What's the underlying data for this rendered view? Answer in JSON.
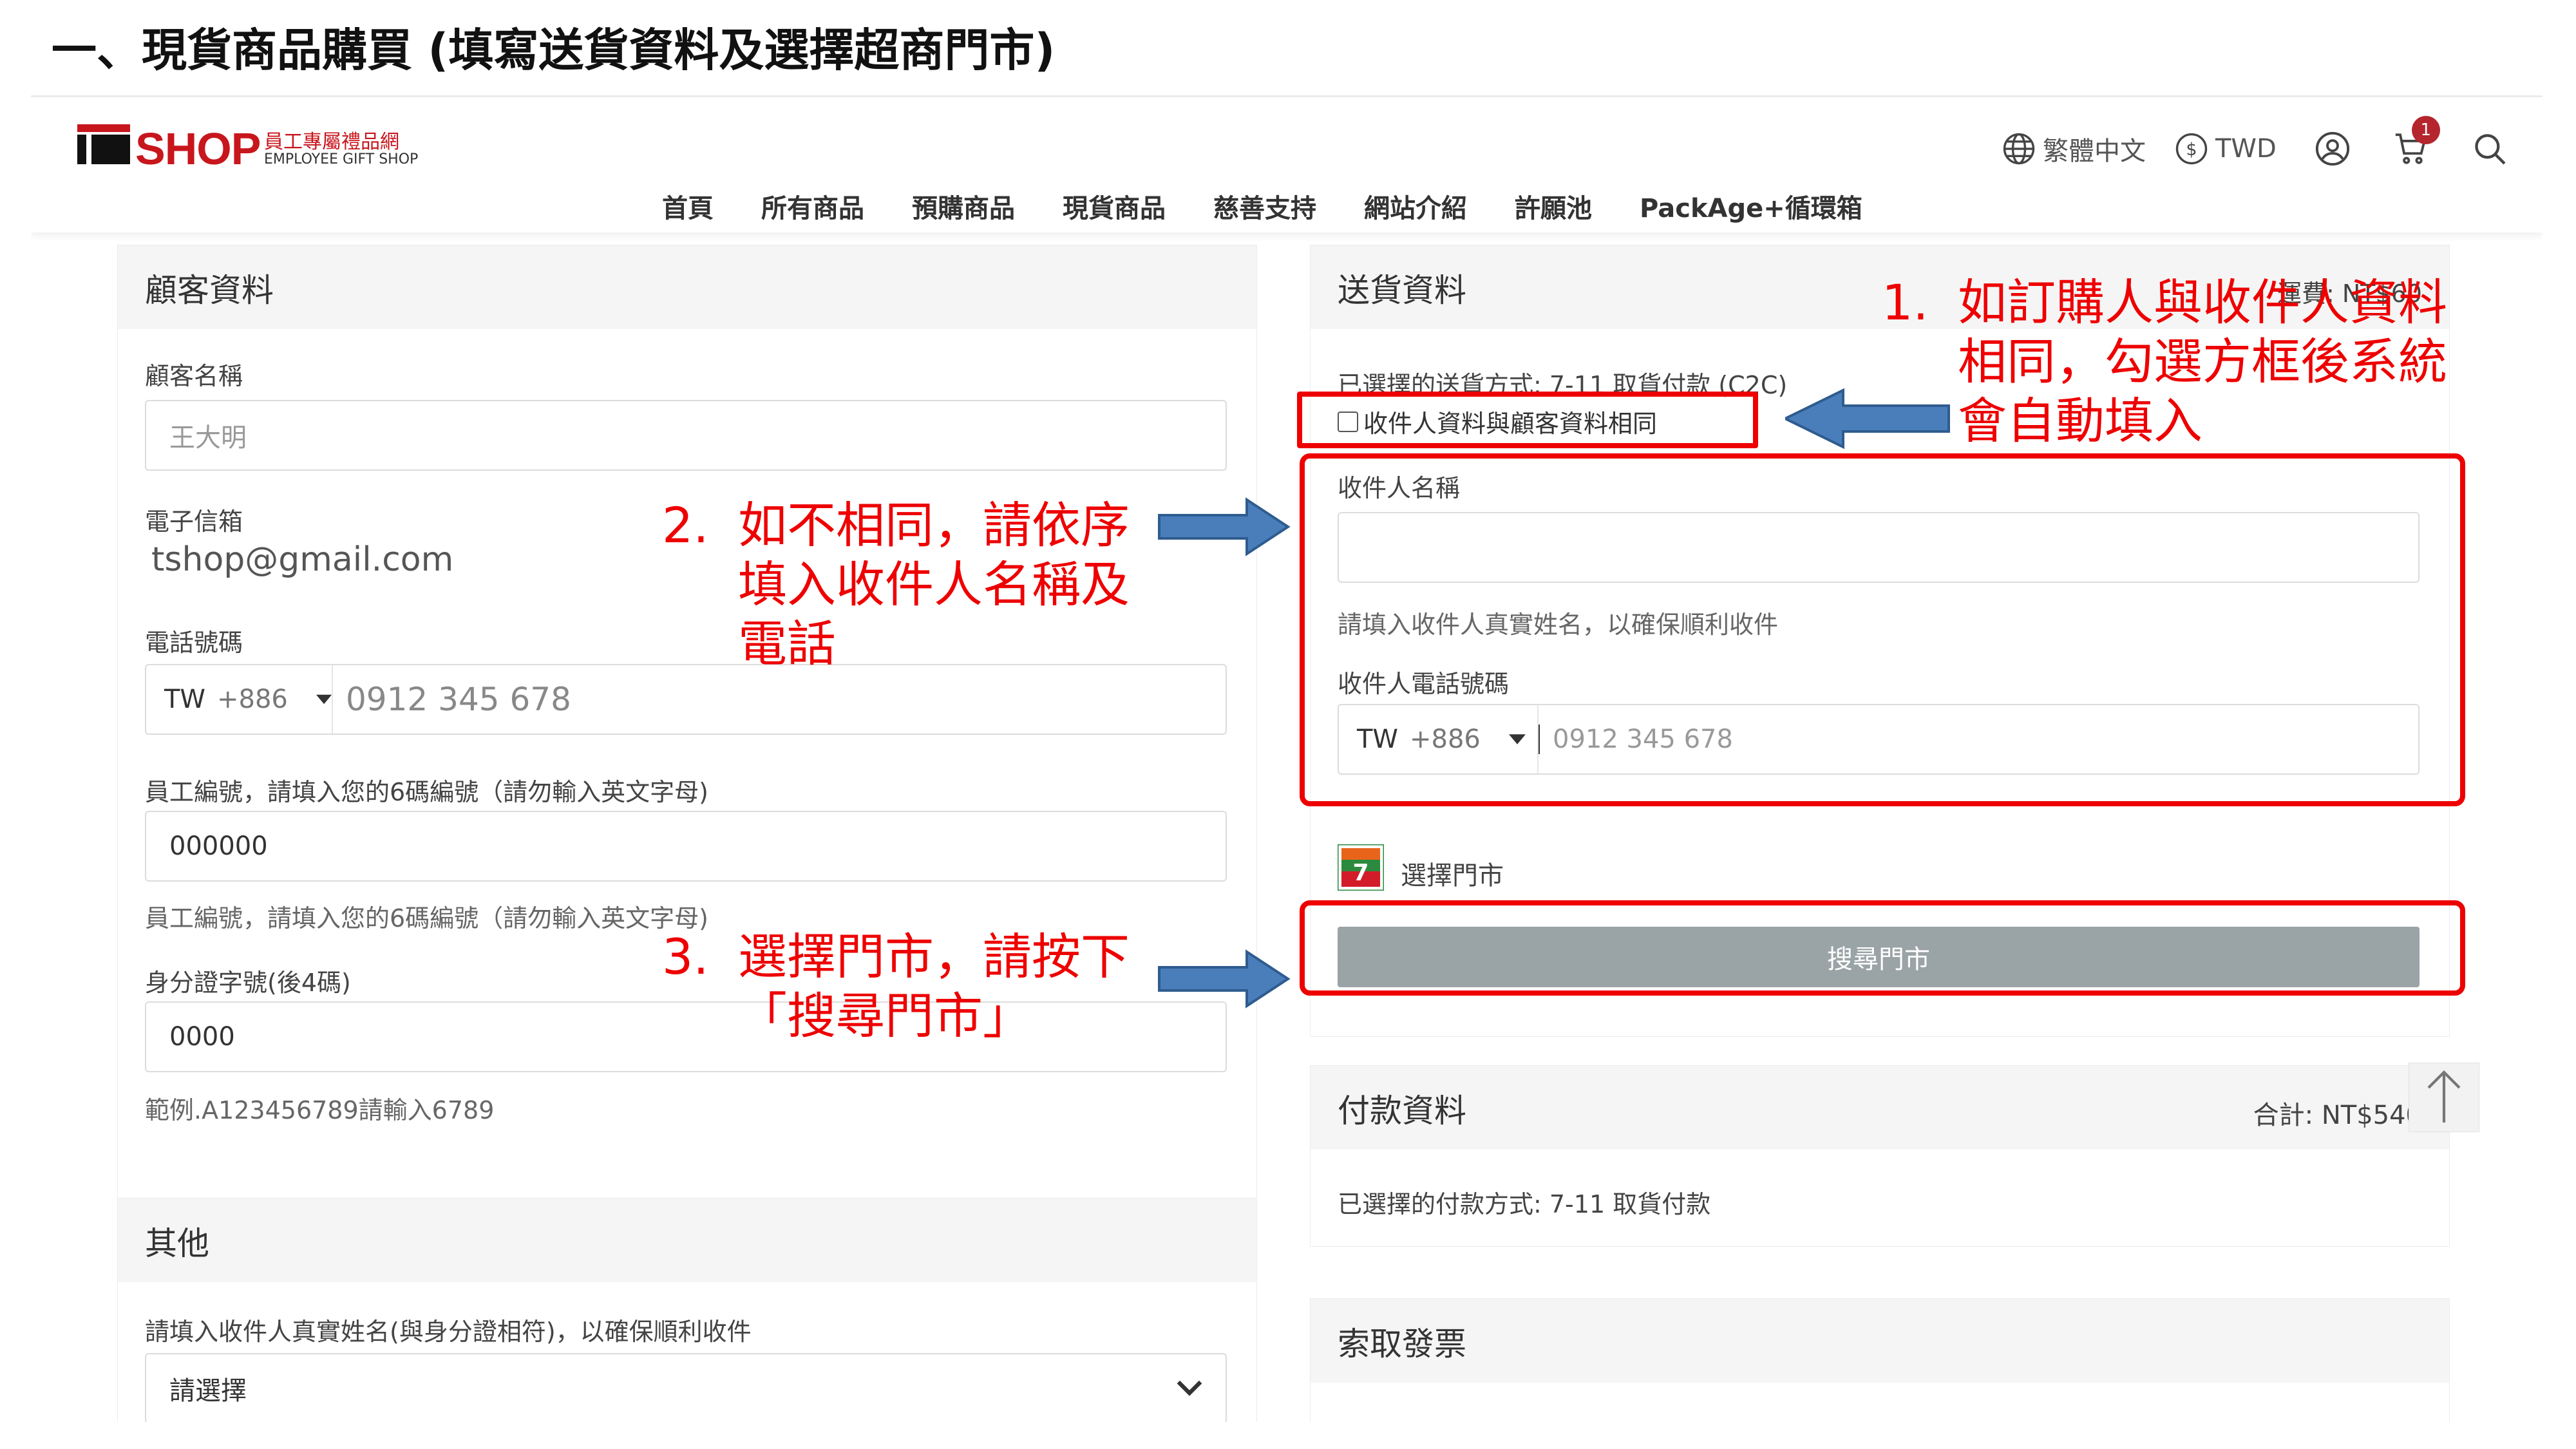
{
  "slide_title": "一、現貨商品購買 (填寫送貨資料及選擇超商門市)",
  "header": {
    "logo_text": "SHOP",
    "logo_sub_zh": "員工專屬禮品網",
    "logo_sub_en": "EMPLOYEE GIFT SHOP",
    "language": "繁體中文",
    "currency": "TWD",
    "cart_count": "1",
    "nav": [
      "首頁",
      "所有商品",
      "預購商品",
      "現貨商品",
      "慈善支持",
      "網站介紹",
      "許願池",
      "PackAge+循環箱"
    ]
  },
  "customer": {
    "title": "顧客資料",
    "name_label": "顧客名稱",
    "name_value": "王大明",
    "email_label": "電子信箱",
    "email_value": "tshop@gmail.com",
    "phone_label": "電話號碼",
    "phone_country": "TW",
    "phone_code": "+886",
    "phone_value": "0912 345 678",
    "employee_label": "員工編號，請填入您的6碼編號（請勿輸入英文字母)",
    "employee_value": "000000",
    "employee_helper": "員工編號，請填入您的6碼編號（請勿輸入英文字母)",
    "id_label": "身分證字號(後4碼)",
    "id_value": "0000",
    "id_helper": "範例.A123456789請輸入6789"
  },
  "other": {
    "title": "其他",
    "field_label": "請填入收件人真實姓名(與身分證相符)，以確保順利收件",
    "select_value": "請選擇"
  },
  "delivery": {
    "title": "送貨資料",
    "shipping_fee": "運費: NT$60",
    "method": "已選擇的送貨方式: 7-11 取貨付款 (C2C)",
    "same_checkbox_label": "收件人資料與顧客資料相同",
    "receiver_name_label": "收件人名稱",
    "receiver_name_helper": "請填入收件人真實姓名，以確保順利收件",
    "receiver_phone_label": "收件人電話號碼",
    "receiver_phone_country": "TW",
    "receiver_phone_code": "+886",
    "receiver_phone_placeholder": "0912 345 678",
    "store_brand": "7-ELEVEN",
    "store_label": "選擇門市",
    "search_store_button": "搜尋門市"
  },
  "payment": {
    "title": "付款資料",
    "total": "合計: NT$540",
    "method": "已選擇的付款方式: 7-11 取貨付款"
  },
  "invoice": {
    "title": "索取發票"
  },
  "annotations": {
    "a1_num": "1.",
    "a1_lines": [
      "如訂購人與收件人資料",
      "相同，勾選方框後系統",
      "會自動填入"
    ],
    "a2_num": "2.",
    "a2_lines": [
      "如不相同，請依序",
      "填入收件人名稱及",
      "電話"
    ],
    "a3_num": "3.",
    "a3_lines": [
      "選擇門市，請按下",
      "「搜尋門市」"
    ]
  },
  "colors": {
    "annotation_red": "#e00000",
    "arrow_blue": "#4a7ebb",
    "brand_red": "#c8161d",
    "button_gray": "#9aa3a6",
    "badge": "#b4252d"
  }
}
